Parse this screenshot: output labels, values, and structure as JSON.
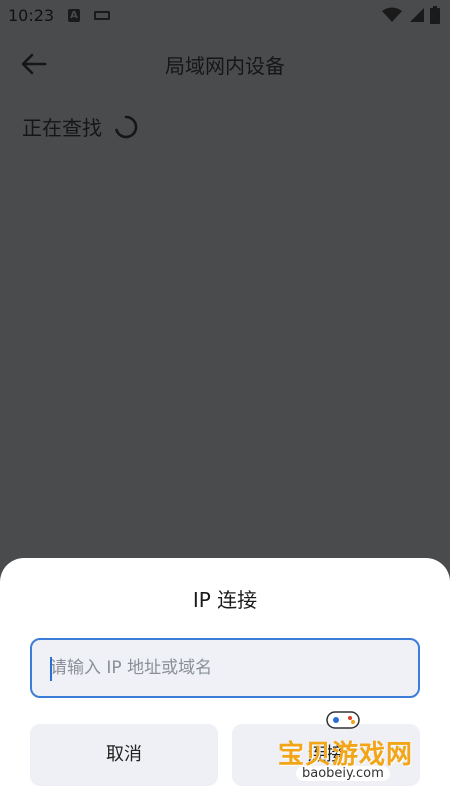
{
  "status_bar": {
    "time": "10:23"
  },
  "header": {
    "title": "局域网内设备"
  },
  "main": {
    "searching_label": "正在查找"
  },
  "dialog": {
    "title": "IP 连接",
    "input_placeholder": "请输入 IP 地址或域名",
    "input_value": "",
    "cancel_label": "取消",
    "confirm_label": "连接"
  },
  "watermark": {
    "text": "宝贝游戏网",
    "url": "baobeiy.com"
  },
  "colors": {
    "accent": "#3b7dd8",
    "scrim": "#4a4b4d",
    "watermark": "#f2a516"
  }
}
